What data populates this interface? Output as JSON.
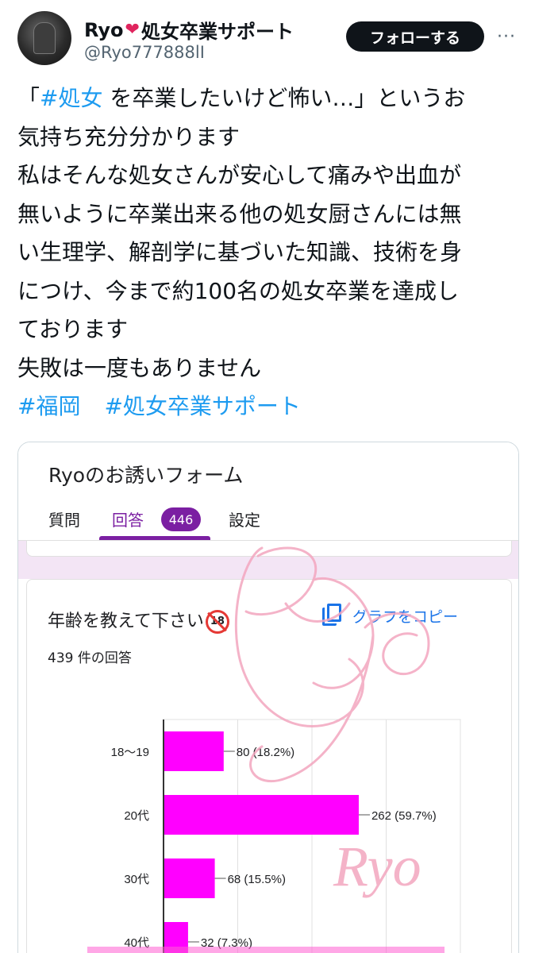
{
  "post": {
    "display_name": "Ryo",
    "display_name_suffix": "処女卒業サポート",
    "handle": "@Ryo777888lI",
    "follow_label": "フォローする",
    "more_icon": "more-icon",
    "text_lines": [
      {
        "pre": "「",
        "tag": "#処女",
        "post": " を卒業したいけど怖い…」というお"
      },
      {
        "pre": "気持ち充分分かります",
        "tag": "",
        "post": ""
      },
      {
        "pre": "私はそんな処女さんが安心して痛みや出血が",
        "tag": "",
        "post": ""
      },
      {
        "pre": "無いように卒業出来る他の処女厨さんには無",
        "tag": "",
        "post": ""
      },
      {
        "pre": "い生理学、解剖学に基づいた知識、技術を身",
        "tag": "",
        "post": ""
      },
      {
        "pre": "につけ、今まで約100名の処女卒業を達成し",
        "tag": "",
        "post": ""
      },
      {
        "pre": "ております",
        "tag": "",
        "post": ""
      },
      {
        "pre": "失敗は一度もありません",
        "tag": "",
        "post": ""
      }
    ],
    "hashtags": [
      "#福岡",
      "#処女卒業サポート"
    ]
  },
  "form": {
    "title": "Ryoのお誘いフォーム",
    "tabs": [
      {
        "label": "質問",
        "active": false
      },
      {
        "label": "回答",
        "active": true,
        "badge": "446"
      },
      {
        "label": "設定",
        "active": false
      }
    ],
    "accent_color": "#7b1fa2",
    "question": {
      "title": "年齢を教えて下さい",
      "icon": "no-under-18-icon",
      "icon_text": "18",
      "copy_label": "グラフをコピー",
      "response_count": "439 件の回答"
    }
  },
  "watermark": {
    "script_text": "Ryo",
    "serif_text": "Ryo"
  },
  "chart_data": {
    "type": "bar",
    "orientation": "horizontal",
    "categories": [
      "18〜19",
      "20代",
      "30代",
      "40代"
    ],
    "values": [
      80,
      262,
      68,
      32
    ],
    "labels": [
      "80 (18.2%)",
      "262 (59.7%)",
      "68 (15.5%)",
      "32 (7.3%)"
    ],
    "color": "#ff00ff",
    "xlim": [
      0,
      400
    ],
    "grid": true
  }
}
